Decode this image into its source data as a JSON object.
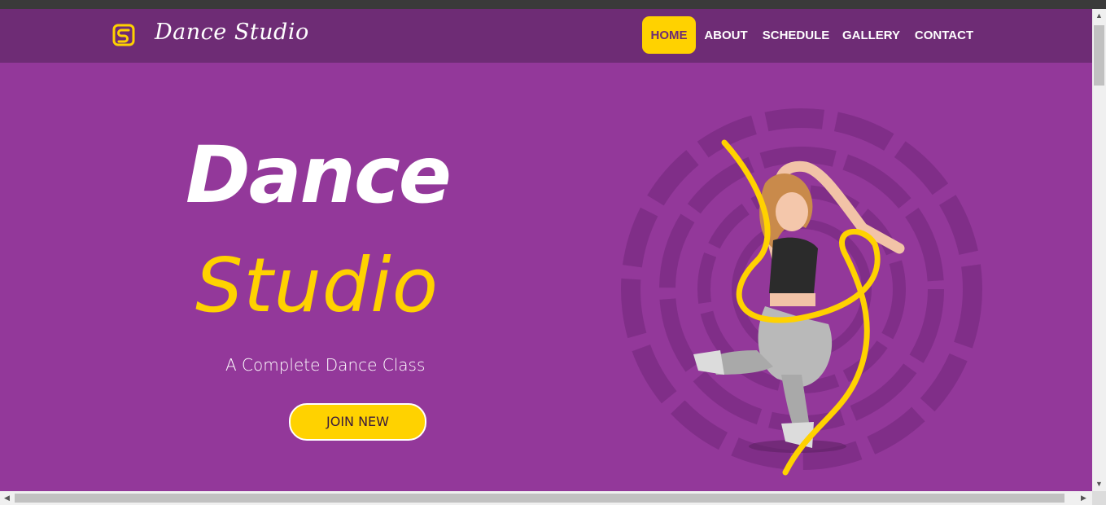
{
  "brand": {
    "name": "Dance Studio",
    "logo_icon": "ds-logo-icon",
    "accent": "#ffd200",
    "nav_bg": "#6e2c75",
    "page_bg": "#93389a"
  },
  "nav": {
    "items": [
      {
        "label": "HOME",
        "active": true
      },
      {
        "label": "ABOUT"
      },
      {
        "label": "SCHEDULE"
      },
      {
        "label": "GALLERY"
      },
      {
        "label": "CONTACT"
      }
    ]
  },
  "hero": {
    "title_line1": "Dance",
    "title_line2": "Studio",
    "subtitle": "A Complete Dance Class",
    "cta_label": "JOIN NEW",
    "image": "dancer-illustration"
  },
  "scrollbars": {
    "vertical_up": "▲",
    "vertical_down": "▼",
    "horizontal_left": "◀",
    "horizontal_right": "▶"
  }
}
